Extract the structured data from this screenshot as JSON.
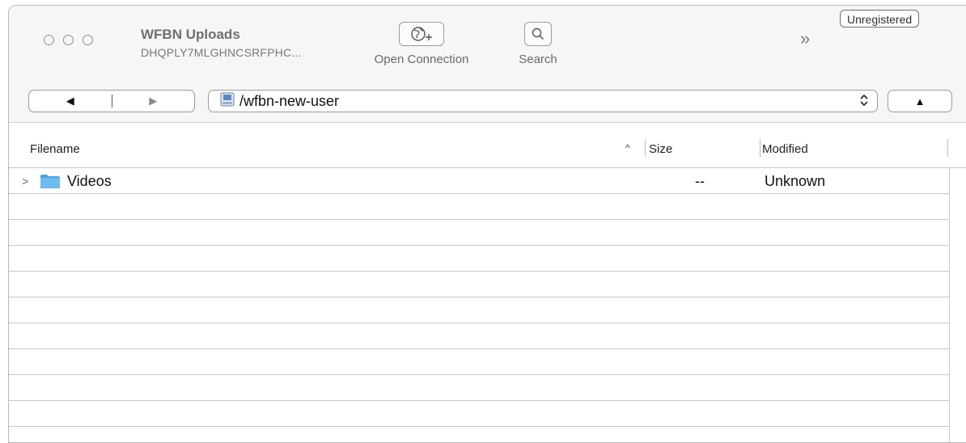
{
  "window": {
    "title": "WFBN Uploads",
    "subtitle": "DHQPLY7MLGHNCSRFPHC...",
    "registration_badge": "Unregistered"
  },
  "toolbar": {
    "open_connection_label": "Open Connection",
    "search_label": "Search",
    "overflow_label": "»"
  },
  "navbar": {
    "back_glyph": "◀",
    "forward_glyph": "▶",
    "path": "/wfbn-new-user",
    "stepper_glyph": "◇",
    "up_glyph": "▲"
  },
  "table": {
    "columns": {
      "filename": "Filename",
      "size": "Size",
      "modified": "Modified"
    },
    "sort_indicator": "^",
    "rows": [
      {
        "name": "Videos",
        "size": "--",
        "modified": "Unknown",
        "type": "folder",
        "icon": "folder-icon",
        "expand_glyph": ">"
      }
    ]
  },
  "colors": {
    "folder": "#5fb0e6",
    "window_bg": "#f6f6f6",
    "grid_line": "#c7c7c7"
  }
}
